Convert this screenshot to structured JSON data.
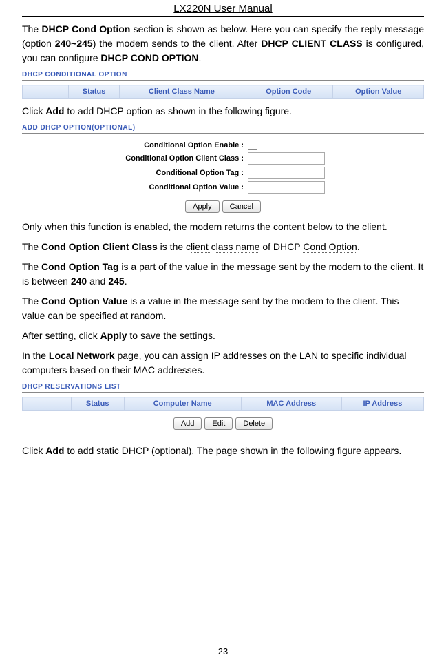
{
  "header": {
    "title": "LX220N User Manual"
  },
  "para1": {
    "t1": "The ",
    "b1": "DHCP Cond Option",
    "t2": " section is shown as below. Here you can specify the reply message (option ",
    "b2": "240~245",
    "t3": ") the modem sends to the client. After ",
    "b3": "DHCP CLIENT CLASS",
    "t4": " is configured, you can configure ",
    "b4": "DHCP COND OPTION",
    "t5": "."
  },
  "caption1": "DHCP CONDITIONAL OPTION",
  "table1": {
    "h1": "Status",
    "h2": "Client Class Name",
    "h3": "Option Code",
    "h4": "Option Value"
  },
  "para2": {
    "t1": "Click ",
    "b1": "Add",
    "t2": " to add DHCP option as shown in the following figure."
  },
  "caption2": "ADD DHCP OPTION(OPTIONAL)",
  "form": {
    "l1": "Conditional Option Enable :",
    "l2": "Conditional Option Client Class :",
    "l3": "Conditional Option Tag :",
    "l4": "Conditional Option Value :",
    "apply": "Apply",
    "cancel": "Cancel"
  },
  "para3": "Only when this function is enabled, the modem returns the content below to the client.",
  "para4": {
    "t1": "The ",
    "b1": "Cond Option Client Class",
    "t2": " is the c",
    "d1": "lient ",
    "t3": "c",
    "d2": "lass name",
    "t4": " of DHCP ",
    "d3": "Cond Option",
    "t5": "."
  },
  "para5": {
    "t1": "The ",
    "b1": "Cond Option Tag",
    "t2": " is a part of the value in the message sent by the modem to the client. It is between ",
    "b2": "240",
    "t3": " and ",
    "b3": "245",
    "t4": "."
  },
  "para6": {
    "t1": "The ",
    "b1": "Cond Option Value",
    "t2": " is a value in the message sent by the modem to the client. This value can be specified at random."
  },
  "para7": {
    "t1": "After setting, click ",
    "b1": "Apply",
    "t2": " to save the settings."
  },
  "para8": {
    "t1": "In the ",
    "b1": "Local Network",
    "t2": " page, you can assign IP addresses on the LAN to specific individual computers based on their MAC addresses."
  },
  "caption3": "DHCP RESERVATIONS LIST",
  "table2": {
    "h1": "Status",
    "h2": "Computer Name",
    "h3": "MAC Address",
    "h4": "IP Address"
  },
  "btns2": {
    "add": "Add",
    "edit": "Edit",
    "delete": "Delete"
  },
  "para9": {
    "t1": "Click ",
    "b1": "Add",
    "t2": " to add static DHCP (optional). The page shown in the following figure appears."
  },
  "footer": {
    "page": "23"
  }
}
